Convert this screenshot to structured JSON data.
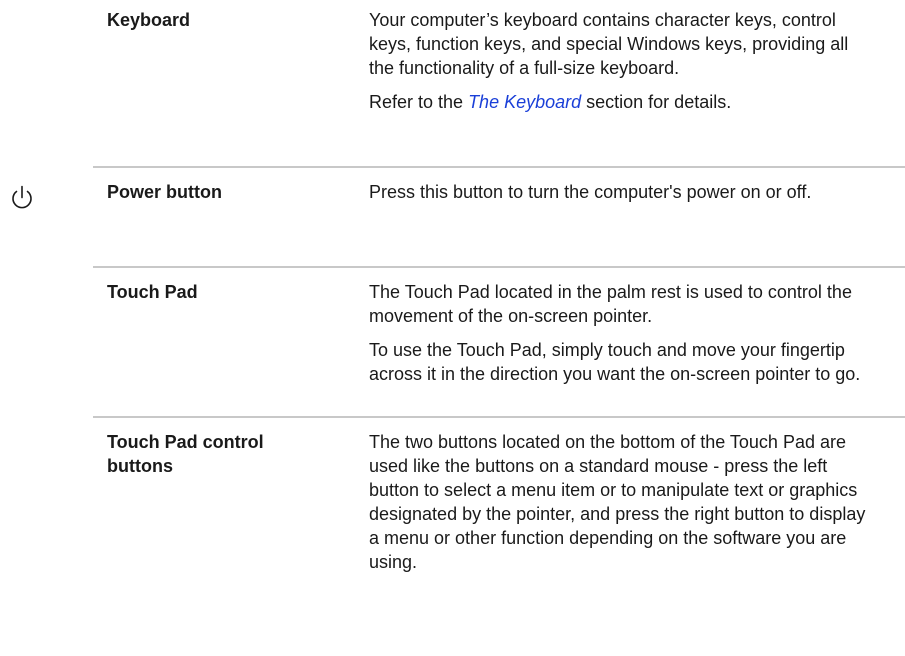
{
  "rows": [
    {
      "term": "Keyboard",
      "desc1": "Your computer’s keyboard contains character keys, control keys, function keys, and special Windows keys, providing all the functionality of a full-size keyboard.",
      "desc2_pre": "Refer to the ",
      "desc2_link": "The Keyboard",
      "desc2_post": " section for details."
    },
    {
      "icon": "power-icon",
      "term": "Power button",
      "desc1": "Press this button to turn the computer's power on or off."
    },
    {
      "term": "Touch Pad",
      "desc1": "The Touch Pad located in the palm rest is used to control the movement of the on-screen pointer.",
      "desc2": "To use the Touch Pad, simply touch and move your fingertip across it in the direction you want the on-screen pointer to go."
    },
    {
      "term": "Touch Pad control buttons",
      "desc1": "The two buttons located on the bottom of the Touch Pad are used like the buttons on a standard mouse - press the left button to select a menu item or to manipulate text or graphics designated by the pointer, and press the right button to display a menu or other function depending on the software you are using."
    }
  ],
  "colors": {
    "text": "#1a1a1a",
    "link": "#1a3fd8",
    "rule": "#c8c8c8"
  }
}
